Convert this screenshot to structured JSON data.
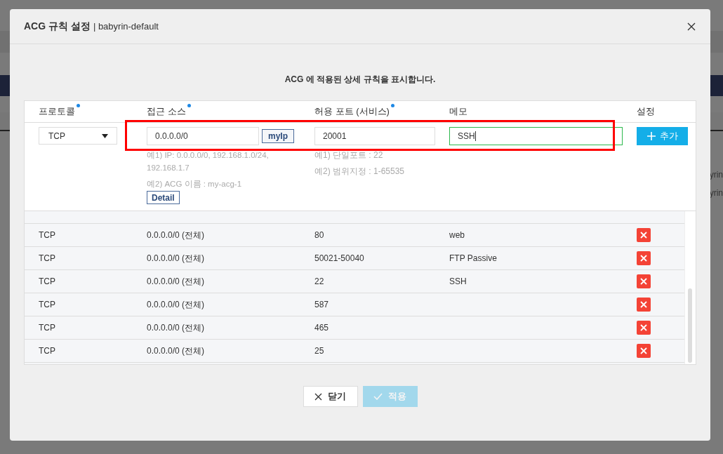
{
  "background_texts": [
    "yrin",
    "yrin"
  ],
  "dialog": {
    "title": "ACG 규칙 설정",
    "subtitle": "| babyrin-default",
    "description": "ACG 에 적용된 상세 규칙을 표시합니다.",
    "columns": [
      {
        "label": "프로토콜",
        "required": true
      },
      {
        "label": "접근 소스",
        "required": true
      },
      {
        "label": "허용 포트 (서비스)",
        "required": true
      },
      {
        "label": "메모",
        "required": false
      },
      {
        "label": "설정",
        "required": false
      }
    ],
    "form": {
      "protocol": "TCP",
      "source": "0.0.0.0/0",
      "myip_button": "myIp",
      "source_hints": [
        "예1) IP: 0.0.0.0/0, 192.168.1.0/24, 192.168.1.7",
        "예2) ACG 이름 : my-acg-1"
      ],
      "detail_button": "Detail",
      "port": "20001",
      "port_hints": [
        "예1) 단일포트 : 22",
        "예2) 범위지정 : 1-65535"
      ],
      "memo": "SSH",
      "memo_focused": true,
      "add_button": "추가",
      "highlighted": true
    },
    "rows": [
      {
        "protocol": "TCP",
        "source": "0.0.0.0/0 (전체)",
        "port": "80",
        "memo": "web"
      },
      {
        "protocol": "TCP",
        "source": "0.0.0.0/0 (전체)",
        "port": "50021-50040",
        "memo": "FTP Passive"
      },
      {
        "protocol": "TCP",
        "source": "0.0.0.0/0 (전체)",
        "port": "22",
        "memo": "SSH"
      },
      {
        "protocol": "TCP",
        "source": "0.0.0.0/0 (전체)",
        "port": "587"
      },
      {
        "protocol": "TCP",
        "source": "0.0.0.0/0 (전체)",
        "port": "465"
      },
      {
        "protocol": "TCP",
        "source": "0.0.0.0/0 (전체)",
        "port": "25"
      }
    ],
    "buttons": [
      {
        "label": "닫기",
        "kind": "close",
        "disabled": false
      },
      {
        "label": "적용",
        "kind": "apply",
        "disabled": true
      }
    ]
  }
}
